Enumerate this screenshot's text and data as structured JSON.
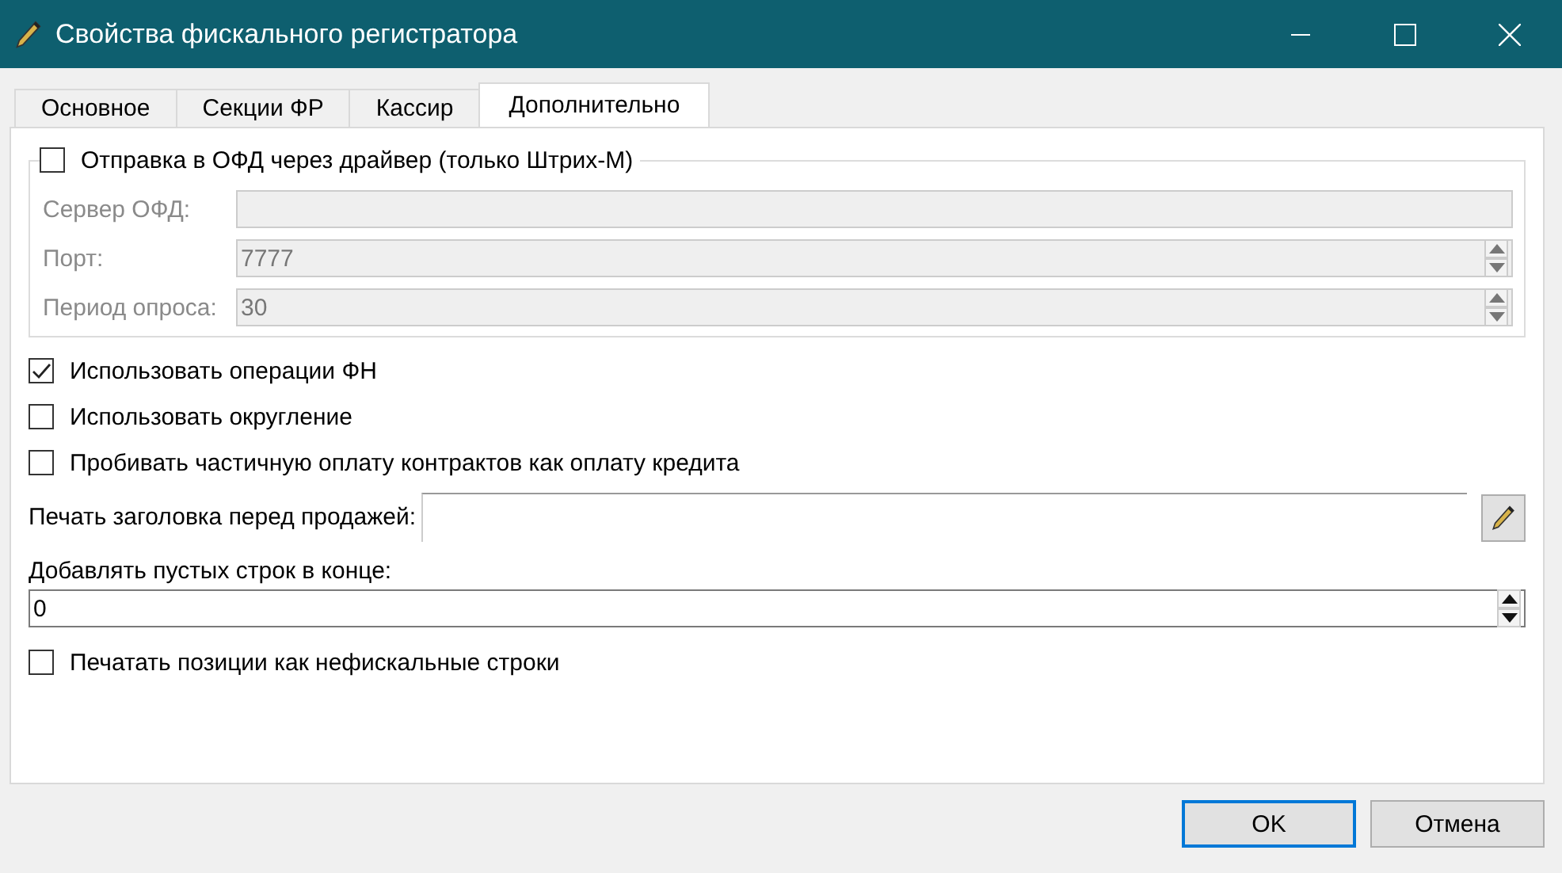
{
  "window": {
    "title": "Свойства фискального регистратора"
  },
  "tabs": [
    {
      "label": "Основное",
      "selected": false
    },
    {
      "label": "Секции ФР",
      "selected": false
    },
    {
      "label": "Кассир",
      "selected": false
    },
    {
      "label": "Дополнительно",
      "selected": true
    }
  ],
  "ofd_group": {
    "label": "Отправка в ОФД через драйвер (только Штрих-М)",
    "checked": false,
    "fields": [
      {
        "label": "Сервер ОФД:",
        "kind": "text"
      },
      {
        "label": "Порт:",
        "value": "7777",
        "kind": "spin"
      },
      {
        "label": "Период опроса:",
        "value": "30",
        "kind": "spin"
      }
    ]
  },
  "options": [
    {
      "label": "Использовать операции ФН",
      "checked": true
    },
    {
      "label": "Использовать округление",
      "checked": false
    },
    {
      "label": "Пробивать частичную оплату контрактов как оплату кредита",
      "checked": false
    }
  ],
  "header_print": {
    "label": "Печать заголовка перед продажей:"
  },
  "blank_lines": {
    "label": "Добавлять пустых строк в конце:",
    "value": "0"
  },
  "options_after": [
    {
      "label": "Печатать позиции как нефискальные строки",
      "checked": false
    }
  ],
  "buttons": [
    {
      "label": "OK",
      "default": true
    },
    {
      "label": "Отмена",
      "default": false
    }
  ]
}
